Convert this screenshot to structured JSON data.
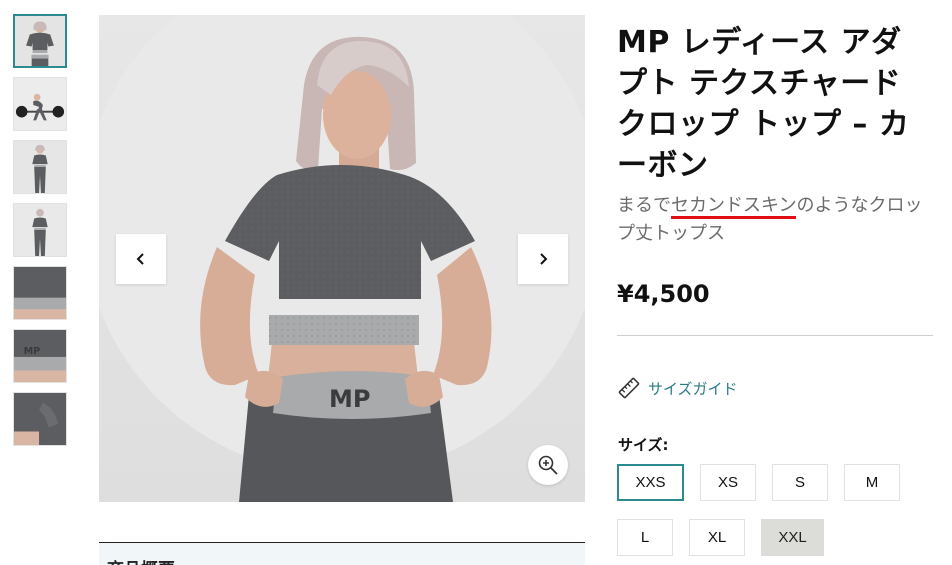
{
  "product": {
    "title": "MP レディース アダプト テクスチャード クロップ トップ – カーボン",
    "subtitle_before": "まるで",
    "subtitle_highlight": "セカンドスキン",
    "subtitle_after": "のようなクロップ丈トップス",
    "price": "¥4,500"
  },
  "gallery": {
    "thumbnails": [
      {
        "name": "front-view",
        "active": true
      },
      {
        "name": "deadlift-pose",
        "active": false
      },
      {
        "name": "full-body-front",
        "active": false
      },
      {
        "name": "full-body-back",
        "active": false
      },
      {
        "name": "waistband-detail",
        "active": false
      },
      {
        "name": "logo-detail",
        "active": false
      },
      {
        "name": "sleeve-detail",
        "active": false
      }
    ],
    "main_image_alt": "model-wearing-crop-top",
    "prev_icon": "chevron-left-icon",
    "next_icon": "chevron-right-icon",
    "zoom_icon": "zoom-in-icon"
  },
  "size_guide": {
    "icon": "ruler-icon",
    "label": "サイズガイド"
  },
  "sizes": {
    "label": "サイズ:",
    "options": [
      "XXS",
      "XS",
      "S",
      "M",
      "L",
      "XL",
      "XXL"
    ],
    "selected": "XXS",
    "unavailable": [
      "XXL"
    ]
  },
  "below_panel": {
    "heading": "商品概要"
  },
  "colors": {
    "accent": "#2b8b8f",
    "link": "#2a7c84",
    "highlight_underline": "#e10d12",
    "garment": "#5b5d60",
    "waistband": "#a8aaab"
  }
}
